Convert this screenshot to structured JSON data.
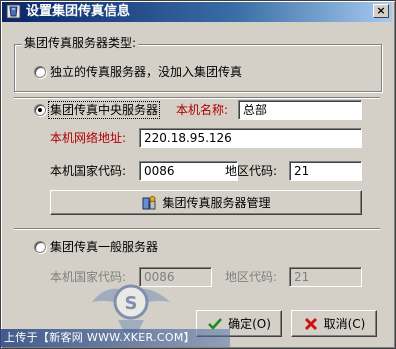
{
  "window": {
    "title": "设置集团传真信息",
    "close_glyph": "×"
  },
  "group_type": {
    "label": "集团传真服务器类型:",
    "option_standalone": "独立的传真服务器，没加入集团传真"
  },
  "central": {
    "option_label": "集团传真中央服务器",
    "selected": true,
    "name_label": "本机名称:",
    "name_value": "总部",
    "net_label": "本机网络地址:",
    "net_value": "220.18.95.126",
    "country_label": "本机国家代码:",
    "country_value": "0086",
    "area_label": "地区代码:",
    "area_value": "21",
    "manage_button": "集团传真服务器管理"
  },
  "general": {
    "option_label": "集团传真一般服务器",
    "country_label": "本机国家代码:",
    "country_value": "0086",
    "area_label": "地区代码:",
    "area_value": "21"
  },
  "buttons": {
    "ok": "确定(O)",
    "cancel": "取消(C)"
  },
  "watermark": {
    "text": "上传于【新客网 WWW.XKER.COM】"
  },
  "colors": {
    "title_start": "#0a246a",
    "title_end": "#a6caf0",
    "accent_red": "#b00000",
    "face": "#d4d0c8"
  }
}
